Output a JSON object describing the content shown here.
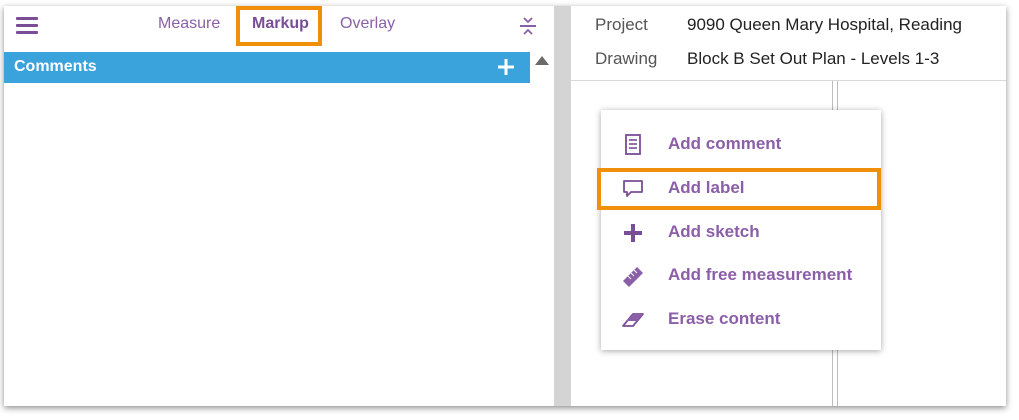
{
  "toolbar": {
    "tabs": [
      {
        "label": "Measure"
      },
      {
        "label": "Markup"
      },
      {
        "label": "Overlay"
      }
    ],
    "active_tab": "Markup"
  },
  "comments": {
    "title": "Comments"
  },
  "project_info": {
    "project_label": "Project",
    "project_value": "9090 Queen Mary Hospital, Reading",
    "drawing_label": "Drawing",
    "drawing_value": "Block B Set Out Plan - Levels 1-3"
  },
  "context_menu": {
    "items": [
      {
        "label": "Add comment",
        "icon": "document-icon"
      },
      {
        "label": "Add label",
        "icon": "speech-bubble-icon"
      },
      {
        "label": "Add sketch",
        "icon": "plus-icon"
      },
      {
        "label": "Add free measurement",
        "icon": "ruler-icon"
      },
      {
        "label": "Erase content",
        "icon": "eraser-icon"
      }
    ],
    "highlighted_item": "Add label"
  },
  "colors": {
    "accent_purple": "#8b5fa8",
    "comments_bar": "#3aa3dc",
    "highlight_orange": "#f0900a"
  }
}
